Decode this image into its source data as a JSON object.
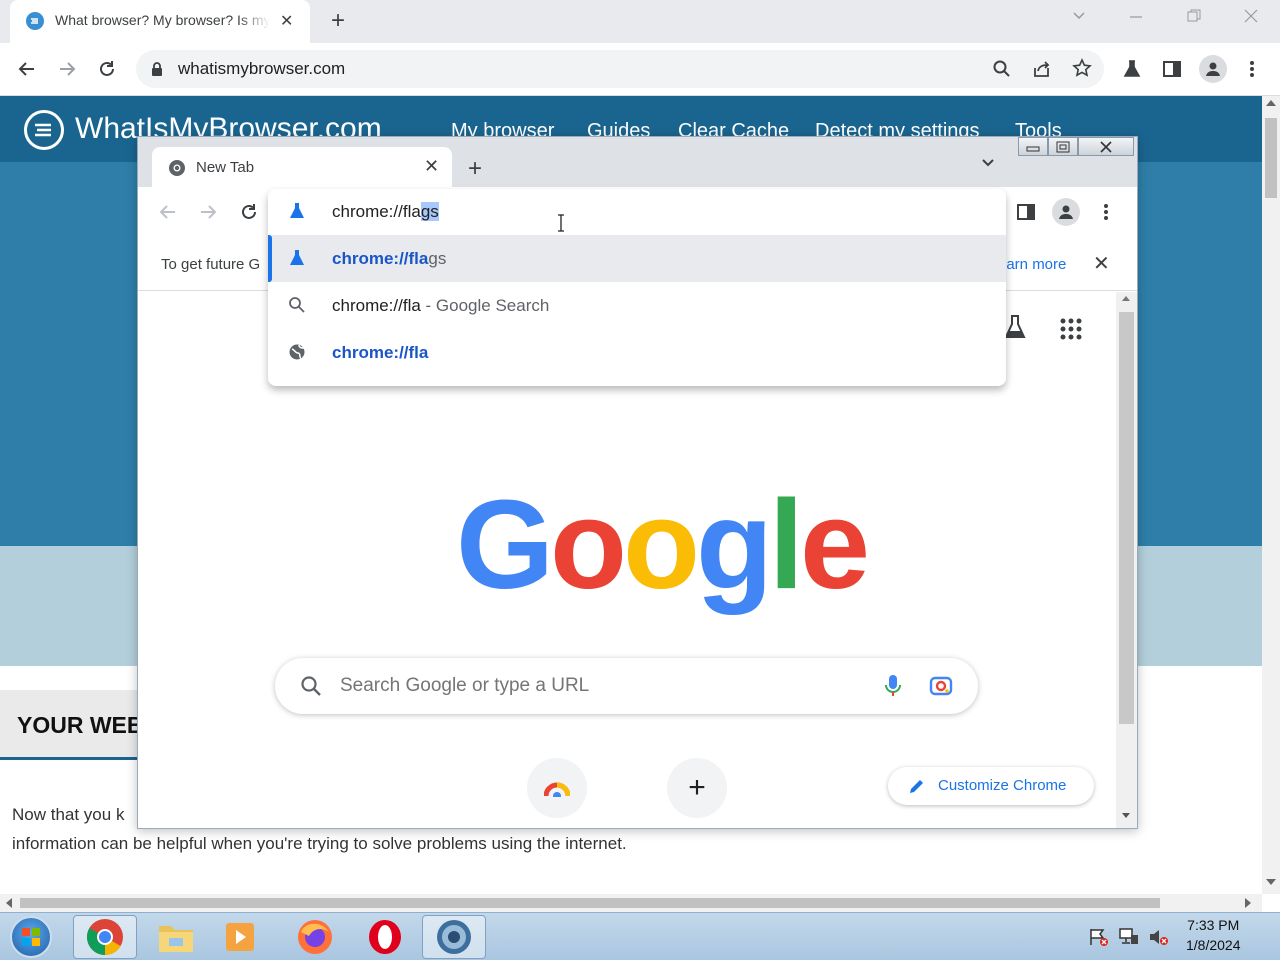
{
  "outer_window": {
    "tab_title": "What browser? My browser? Is my browser up to date?",
    "tab_close": "✕",
    "new_tab": "+",
    "url": "whatismybrowser.com"
  },
  "site": {
    "name": "WhatIsMyBrowser.com",
    "nav": [
      "My browser",
      "Guides",
      "Clear Cache",
      "Detect my settings",
      "Tools"
    ],
    "section_heading": "YOUR WEB",
    "paragraph": "Now that you know what browser you're using, This information can be helpful when you're trying to solve problems using the internet.",
    "paragraph_visible_line1": "Now that you k",
    "paragraph_visible_line2": "information can be helpful when you're trying to solve problems using the internet."
  },
  "inner_window": {
    "tab_title": "New Tab",
    "tab_close": "✕",
    "new_tab": "+",
    "infobar_text": "To get future G",
    "infobar_learn_more": "earn more",
    "infobar_close": "✕"
  },
  "omnibox": {
    "typed": "chrome://fla",
    "autocomplete": "gs",
    "suggestions": [
      {
        "bold": "chrome://fla",
        "rest": "gs",
        "icon": "flask-icon"
      },
      {
        "bold": "chrome://fla",
        "rest": " - Google Search",
        "icon": "search-icon"
      },
      {
        "bold": "chrome://fla",
        "rest": "",
        "icon": "globe-icon"
      }
    ]
  },
  "ntp": {
    "logo_letters": [
      "G",
      "o",
      "o",
      "g",
      "l",
      "e"
    ],
    "logo_colors": [
      "#4285f4",
      "#ea4335",
      "#fbbc05",
      "#4285f4",
      "#34a853",
      "#ea4335"
    ],
    "search_placeholder": "Search Google or type a URL",
    "customize_label": "Customize Chrome",
    "add_shortcut": "+"
  },
  "taskbar": {
    "time": "7:33 PM",
    "date": "1/8/2024"
  }
}
